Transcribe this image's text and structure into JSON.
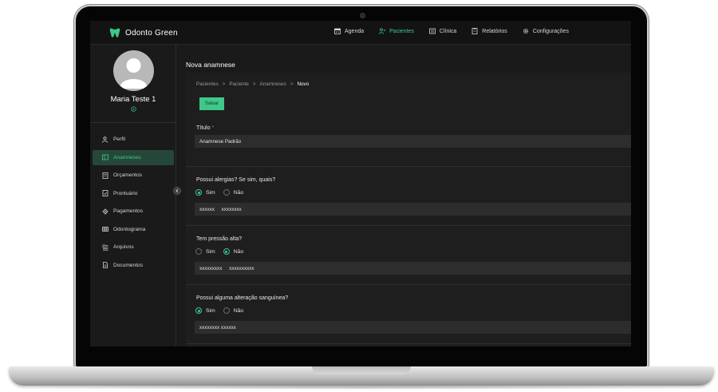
{
  "app": {
    "name": "Odonto Green",
    "accent": "#3ec98b"
  },
  "nav": {
    "items": [
      {
        "label": "Agenda",
        "icon": "calendar-icon",
        "active": false
      },
      {
        "label": "Pacientes",
        "icon": "users-icon",
        "active": true
      },
      {
        "label": "Clínica",
        "icon": "clinic-icon",
        "active": false
      },
      {
        "label": "Relatórios",
        "icon": "report-icon",
        "active": false
      },
      {
        "label": "Configurações",
        "icon": "gear-icon",
        "active": false
      }
    ]
  },
  "patient": {
    "name": "Maria Teste 1"
  },
  "sidebar": {
    "items": [
      {
        "label": "Perfil",
        "icon": "user-icon",
        "active": false
      },
      {
        "label": "Anamneses",
        "icon": "clipboard-icon",
        "active": true
      },
      {
        "label": "Orçamentos",
        "icon": "budget-icon",
        "active": false
      },
      {
        "label": "Prontuário",
        "icon": "record-icon",
        "active": false
      },
      {
        "label": "Pagamentos",
        "icon": "payment-icon",
        "active": false
      },
      {
        "label": "Odontograma",
        "icon": "tooth-chart-icon",
        "active": false
      },
      {
        "label": "Arquivos",
        "icon": "files-icon",
        "active": false
      },
      {
        "label": "Documentos",
        "icon": "document-icon",
        "active": false
      }
    ]
  },
  "main": {
    "page_title": "Nova anamnese",
    "breadcrumb": {
      "items": [
        "Pacientes",
        ">",
        "Paciente",
        ">",
        "Anamneses",
        ">"
      ],
      "current": "Novo"
    },
    "save_label": "Salvar",
    "title_field": {
      "label": "Título",
      "required_mark": "*",
      "value": "Anamnese Padrão"
    },
    "questions": [
      {
        "label": "Possui alergias? Se sim, quais?",
        "option_yes": "Sim",
        "option_no": "Não",
        "selected": "Sim",
        "answer": "xxxxxx     xxxxxxxx"
      },
      {
        "label": "Tem pressão alta?",
        "option_yes": "Sim",
        "option_no": "Não",
        "selected": "Não",
        "answer": "xxxxxxxxx     xxxxxxxxxx"
      },
      {
        "label": "Possui alguma alteração sanguínea?",
        "option_yes": "Sim",
        "option_no": "Não",
        "selected": "Sim",
        "answer": "xxxxxxxx xxxxxx"
      }
    ]
  }
}
